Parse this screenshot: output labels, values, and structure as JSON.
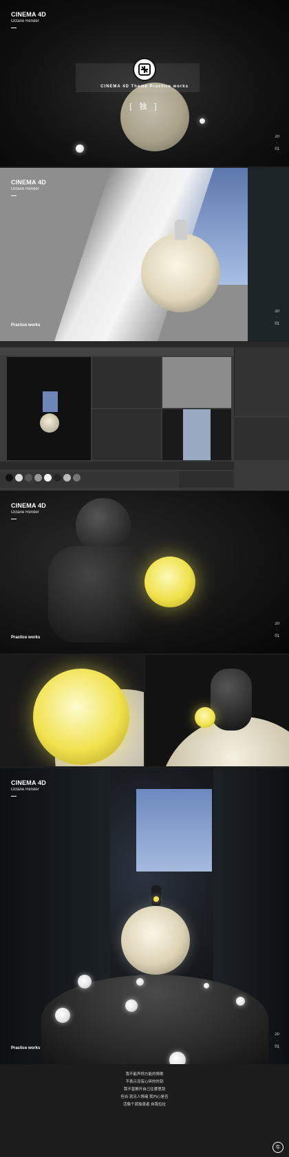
{
  "panel1": {
    "theme": "CINEMA 4D  Theme Practice works",
    "bracket_title": "[  独  ]",
    "year_top": "20",
    "year_dot": "·",
    "year_bottom": "01",
    "logo_char": "牛"
  },
  "header": {
    "title": "CINEMA 4D",
    "subtitle": "Octane Render"
  },
  "practice_label": "Practice works",
  "year": {
    "top": "20",
    "mid": "·",
    "bottom": "01"
  },
  "poem": [
    "我不能声称方能的情歌",
    "不表示没有心碎的时刻",
    "我不曾推开自己往哪里刮",
    "但合   就无人情绪   我内心是否",
    "活像个孤独患者   自我拉扯"
  ],
  "footer_logo": "牛",
  "colors": {
    "moon": "#f1e9cf",
    "orb_yellow": "#f6e95a",
    "sky": "#7d97c6",
    "accent_cyan": "#3fc6d8"
  }
}
